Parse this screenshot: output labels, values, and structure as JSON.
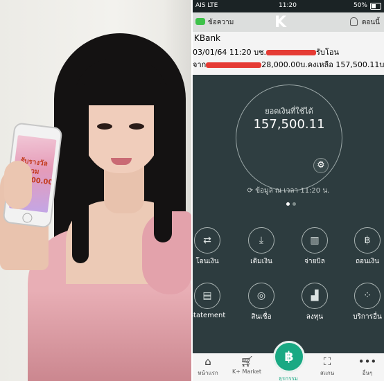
{
  "phone_status": {
    "carrier": "AIS LTE",
    "time": "11:20",
    "battery": "50%"
  },
  "notification": {
    "app_name": "ข้อความ",
    "time": "ตอนนี้",
    "title": "KBank",
    "line1_start": "03/01/64 11:20 บช.",
    "line1_end": "รับโอน",
    "line2_start": "จาก",
    "line2_end": "28,000.00บ.คงเหลือ 157,500.11บ."
  },
  "balance": {
    "label": "ยอดเงินที่ใช้ได้",
    "value": "157,500.11",
    "updated": "ข้อมูล ณ เวลา 11:20 น."
  },
  "handheld_phone": {
    "banner_line1": "รับรางวัลรวม",
    "banner_line2": "28,000.00"
  },
  "actions": [
    {
      "label": "โอนเงิน",
      "icon": "transfer-icon"
    },
    {
      "label": "เติมเงิน",
      "icon": "topup-icon"
    },
    {
      "label": "จ่ายบิล",
      "icon": "barcode-icon"
    },
    {
      "label": "ถอนเงิน",
      "icon": "withdraw-icon"
    },
    {
      "label": "Statement",
      "icon": "document-icon"
    },
    {
      "label": "สินเชื่อ",
      "icon": "loan-icon"
    },
    {
      "label": "ลงทุน",
      "icon": "invest-chart-icon"
    },
    {
      "label": "บริการอื่น",
      "icon": "more-services-icon"
    }
  ],
  "tabs": [
    {
      "label": "หน้าแรก",
      "icon": "home-icon"
    },
    {
      "label": "K+ Market",
      "icon": "basket-icon"
    },
    {
      "label": "ธุรกรรม",
      "icon": "baht-icon"
    },
    {
      "label": "สแกน",
      "icon": "scan-icon"
    },
    {
      "label": "อื่นๆ",
      "icon": "more-dots-icon"
    }
  ],
  "colors": {
    "app_bg": "#2d3c3f",
    "accent": "#19a983",
    "redaction": "#e53b34"
  }
}
